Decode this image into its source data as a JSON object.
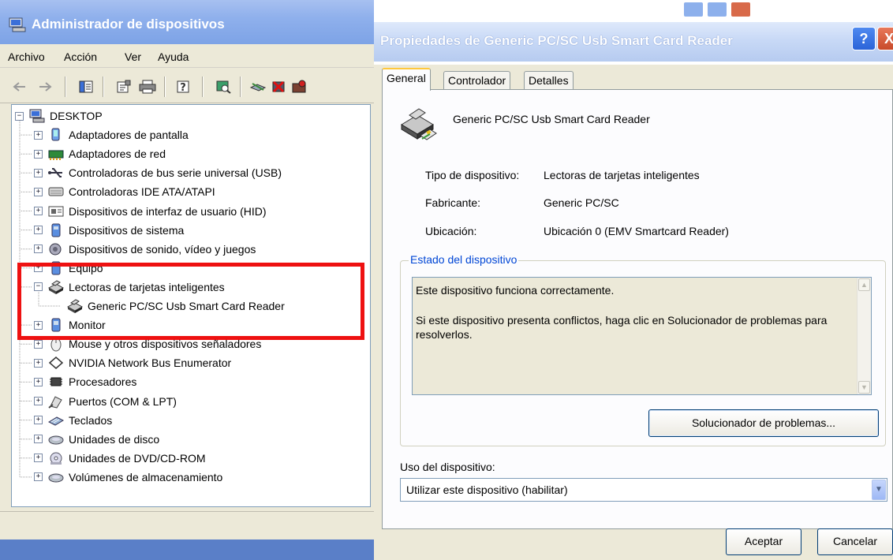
{
  "device_manager": {
    "title": "Administrador de dispositivos",
    "menu": [
      "Archivo",
      "Acción",
      "Ver",
      "Ayuda"
    ],
    "toolbar_icons": [
      "back-icon",
      "forward-icon",
      "console-tree-icon",
      "properties-icon",
      "print-icon",
      "help-icon",
      "scan-hardware-icon",
      "update-driver-icon",
      "uninstall-icon",
      "disable-icon"
    ],
    "tree": [
      {
        "label": "DESKTOP",
        "level": 0,
        "expander": "−",
        "icon": "computer-icon"
      },
      {
        "label": "Adaptadores de pantalla",
        "level": 1,
        "expander": "+",
        "icon": "display-adapter-icon"
      },
      {
        "label": "Adaptadores de red",
        "level": 1,
        "expander": "+",
        "icon": "network-adapter-icon"
      },
      {
        "label": "Controladoras de bus serie universal (USB)",
        "level": 1,
        "expander": "+",
        "icon": "usb-icon"
      },
      {
        "label": "Controladoras IDE ATA/ATAPI",
        "level": 1,
        "expander": "+",
        "icon": "ide-controller-icon"
      },
      {
        "label": "Dispositivos de interfaz de usuario (HID)",
        "level": 1,
        "expander": "+",
        "icon": "hid-icon"
      },
      {
        "label": "Dispositivos de sistema",
        "level": 1,
        "expander": "+",
        "icon": "system-device-icon"
      },
      {
        "label": "Dispositivos de sonido, vídeo y juegos",
        "level": 1,
        "expander": "+",
        "icon": "sound-icon"
      },
      {
        "label": "Equipo",
        "level": 1,
        "expander": "+",
        "icon": "equipment-icon"
      },
      {
        "label": "Lectoras de tarjetas inteligentes",
        "level": 1,
        "expander": "−",
        "icon": "smart-card-reader-icon"
      },
      {
        "label": "Generic PC/SC Usb Smart Card Reader",
        "level": 2,
        "expander": "",
        "icon": "smart-card-reader-icon"
      },
      {
        "label": "Monitor",
        "level": 1,
        "expander": "+",
        "icon": "monitor-icon"
      },
      {
        "label": "Mouse y otros dispositivos señaladores",
        "level": 1,
        "expander": "+",
        "icon": "mouse-icon"
      },
      {
        "label": "NVIDIA Network Bus Enumerator",
        "level": 1,
        "expander": "+",
        "icon": "bus-enumerator-icon"
      },
      {
        "label": "Procesadores",
        "level": 1,
        "expander": "+",
        "icon": "processor-icon"
      },
      {
        "label": "Puertos (COM & LPT)",
        "level": 1,
        "expander": "+",
        "icon": "port-icon"
      },
      {
        "label": "Teclados",
        "level": 1,
        "expander": "+",
        "icon": "keyboard-icon"
      },
      {
        "label": "Unidades de disco",
        "level": 1,
        "expander": "+",
        "icon": "disk-drive-icon"
      },
      {
        "label": "Unidades de DVD/CD-ROM",
        "level": 1,
        "expander": "+",
        "icon": "dvd-icon"
      },
      {
        "label": "Volúmenes de almacenamiento",
        "level": 1,
        "expander": "+",
        "icon": "storage-volume-icon"
      }
    ]
  },
  "properties_dialog": {
    "title": "Propiedades de Generic PC/SC Usb Smart Card Reader",
    "tabs": [
      "General",
      "Controlador",
      "Detalles"
    ],
    "active_tab": "General",
    "device_name": "Generic PC/SC Usb Smart Card Reader",
    "properties": [
      {
        "label": "Tipo de dispositivo:",
        "value": "Lectoras de tarjetas inteligentes"
      },
      {
        "label": "Fabricante:",
        "value": "Generic PC/SC"
      },
      {
        "label": "Ubicación:",
        "value": "Ubicación 0 (EMV Smartcard Reader)"
      }
    ],
    "status": {
      "legend": "Estado del dispositivo",
      "line1": "Este dispositivo funciona correctamente.",
      "line2": "Si este dispositivo presenta conflictos, haga clic en Solucionador de problemas para resolverlos."
    },
    "troubleshoot_label": "Solucionador de problemas...",
    "usage_label": "Uso del dispositivo:",
    "usage_value": "Utilizar este dispositivo (habilitar)",
    "ok_label": "Aceptar",
    "cancel_label": "Cancelar",
    "help_glyph": "?",
    "close_glyph": "X"
  },
  "colors": {
    "highlight": "#ee1111",
    "xp_blue": "#0046d5",
    "dialog_face": "#ece9d8"
  }
}
